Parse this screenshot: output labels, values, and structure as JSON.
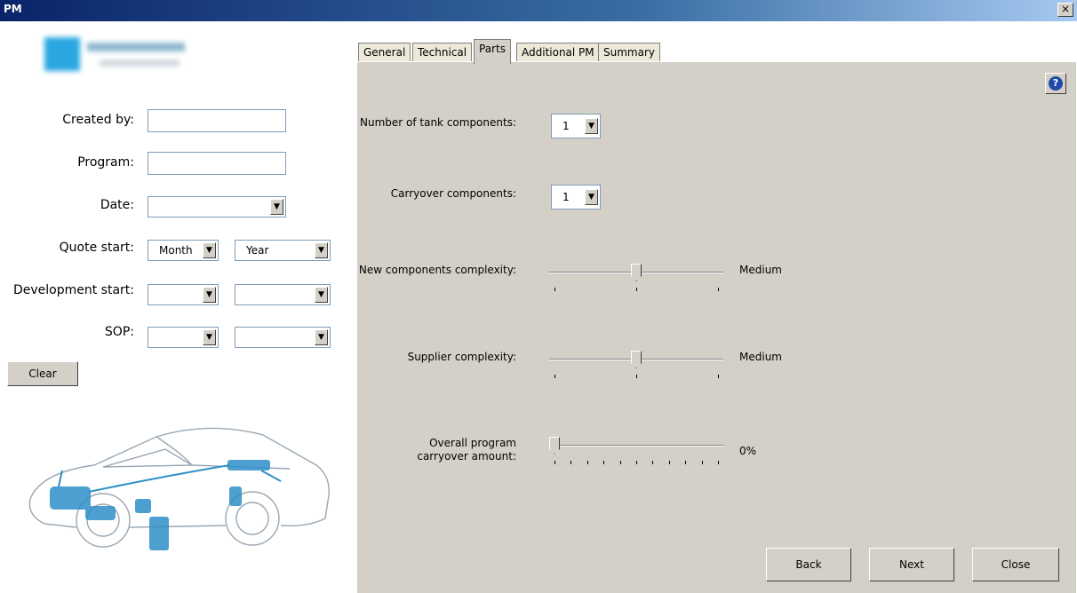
{
  "window": {
    "title": "PM",
    "close_glyph": "×"
  },
  "left": {
    "fields": {
      "created_by": {
        "label": "Created by:",
        "value": ""
      },
      "program": {
        "label": "Program:",
        "value": ""
      },
      "date": {
        "label": "Date:",
        "value": ""
      },
      "quote_start": {
        "label": "Quote start:",
        "month": "Month",
        "year": "Year"
      },
      "development_start": {
        "label": "Development start:",
        "month": "",
        "year": ""
      },
      "sop": {
        "label": "SOP:",
        "month": "",
        "year": ""
      }
    },
    "clear_label": "Clear"
  },
  "tabs": [
    {
      "label": "General",
      "active": false
    },
    {
      "label": "Technical",
      "active": false
    },
    {
      "label": "Parts",
      "active": true
    },
    {
      "label": "Additional PM",
      "active": false
    },
    {
      "label": "Summary",
      "active": false
    }
  ],
  "parts": {
    "tank_components": {
      "label": "Number of tank components:",
      "value": "1"
    },
    "carryover_components": {
      "label": "Carryover components:",
      "value": "1"
    },
    "new_components_complexity": {
      "label": "New components complexity:",
      "value_label": "Medium",
      "level": 0.5,
      "ticks": 3
    },
    "supplier_complexity": {
      "label": "Supplier complexity:",
      "value_label": "Medium",
      "level": 0.5,
      "ticks": 3
    },
    "overall_carryover": {
      "label_line1": "Overall program",
      "label_line2": "carryover amount:",
      "value_label": "0%",
      "level": 0,
      "ticks": 11
    }
  },
  "buttons": {
    "back": "Back",
    "next": "Next",
    "close": "Close"
  },
  "icons": {
    "help": "help-icon",
    "arrow": "chevron-down-icon"
  }
}
